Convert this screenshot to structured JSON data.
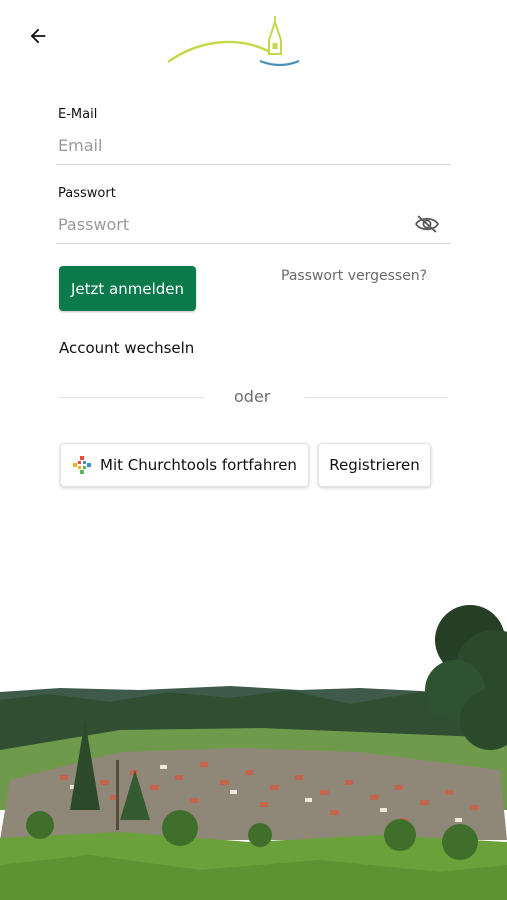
{
  "nav": {
    "back_icon": "arrow-left-icon"
  },
  "logo": {
    "icon": "church-hill-logo"
  },
  "form": {
    "email_label": "E-Mail",
    "email_placeholder": "Email",
    "email_value": "",
    "password_label": "Passwort",
    "password_placeholder": "Passwort",
    "password_value": "",
    "password_toggle_icon": "eye-off-icon",
    "login_button": "Jetzt anmelden",
    "forgot_link": "Passwort vergessen?",
    "switch_account": "Account wechseln"
  },
  "divider": {
    "label": "oder"
  },
  "alt_actions": {
    "churchtools_button": "Mit Churchtools fortfahren",
    "churchtools_icon": "churchtools-cross-icon",
    "register_button": "Registrieren"
  },
  "colors": {
    "primary": "#0a7a4b",
    "logo_green": "#c5d84a",
    "logo_blue": "#4a8fb8"
  }
}
